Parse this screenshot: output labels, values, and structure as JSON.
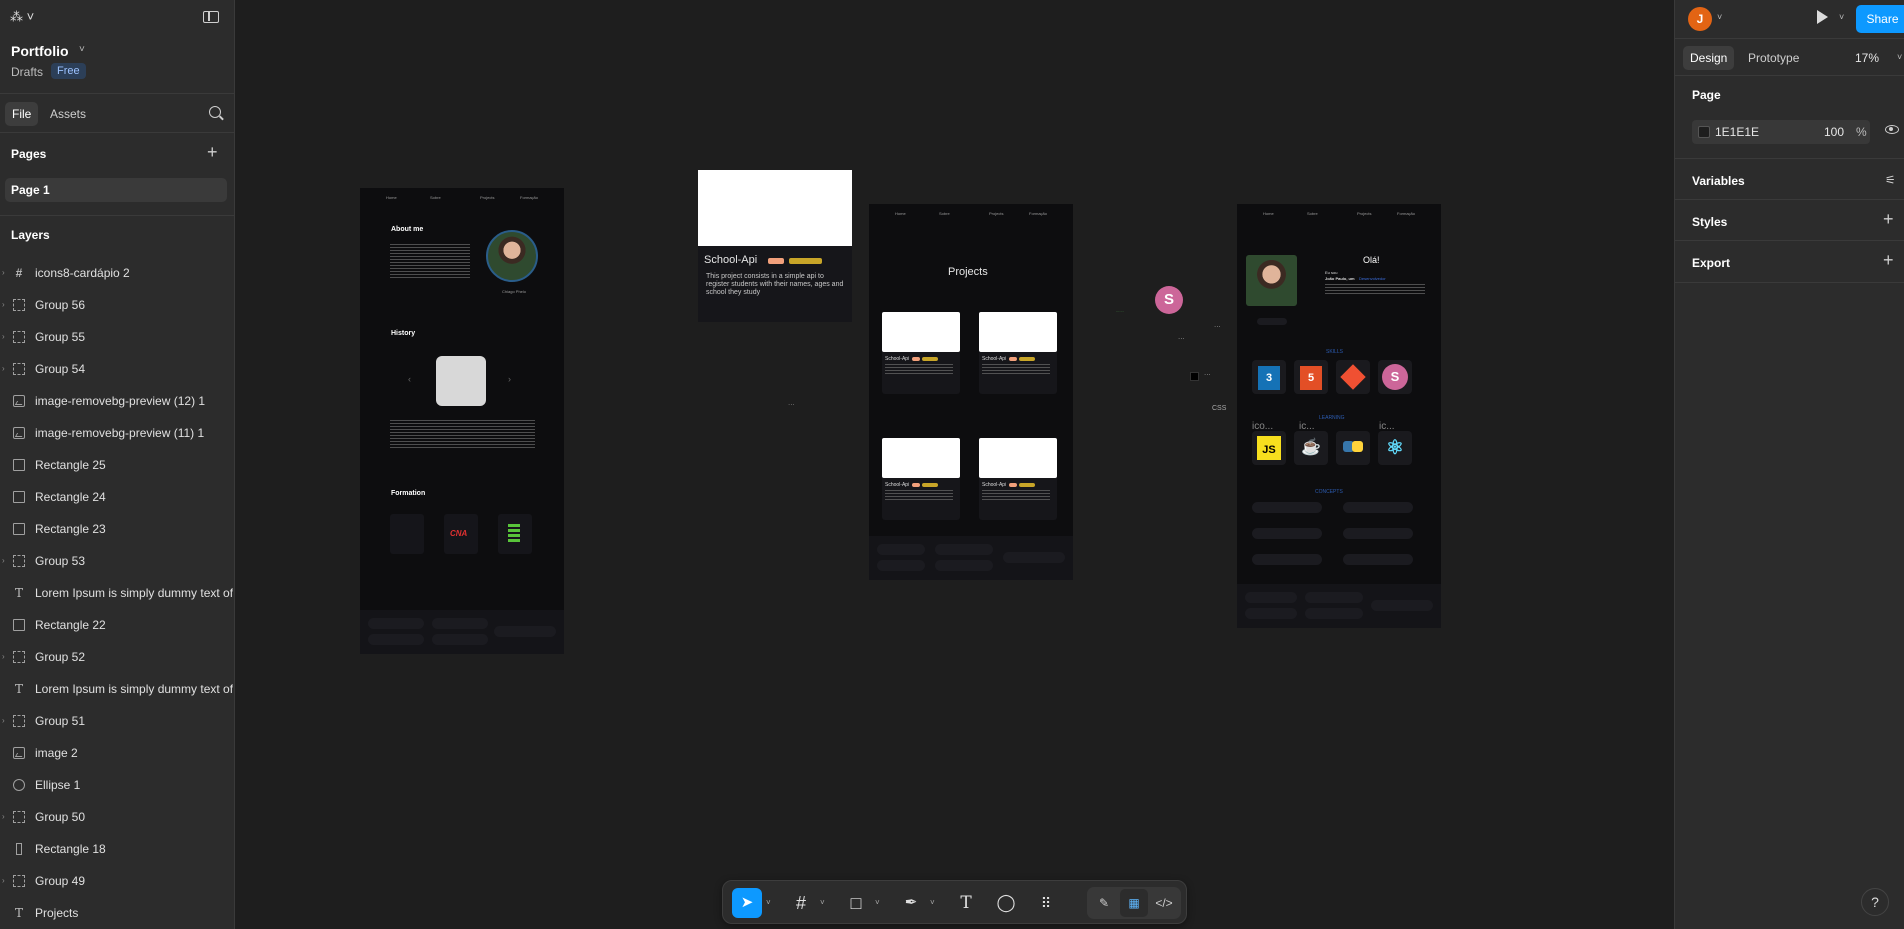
{
  "app": {
    "file_name": "Portfolio",
    "location": "Drafts",
    "plan_badge": "Free"
  },
  "left_panel": {
    "tabs": [
      "File",
      "Assets"
    ],
    "pages_title": "Pages",
    "pages": [
      "Page 1"
    ],
    "layers_title": "Layers",
    "layers": [
      {
        "type": "frame",
        "name": "icons8-cardápio 2"
      },
      {
        "type": "group",
        "name": "Group 56"
      },
      {
        "type": "group",
        "name": "Group 55"
      },
      {
        "type": "group",
        "name": "Group 54"
      },
      {
        "type": "image",
        "name": "image-removebg-preview (12) 1"
      },
      {
        "type": "image",
        "name": "image-removebg-preview (11) 1"
      },
      {
        "type": "rect",
        "name": "Rectangle 25"
      },
      {
        "type": "rect",
        "name": "Rectangle 24"
      },
      {
        "type": "rect",
        "name": "Rectangle 23"
      },
      {
        "type": "group",
        "name": "Group 53"
      },
      {
        "type": "text",
        "name": "Lorem Ipsum is simply dummy text of"
      },
      {
        "type": "rect",
        "name": "Rectangle 22"
      },
      {
        "type": "group",
        "name": "Group 52"
      },
      {
        "type": "text",
        "name": "Lorem Ipsum is simply dummy text of"
      },
      {
        "type": "group",
        "name": "Group 51"
      },
      {
        "type": "image",
        "name": "image 2"
      },
      {
        "type": "ellipse",
        "name": "Ellipse 1"
      },
      {
        "type": "group",
        "name": "Group 50"
      },
      {
        "type": "tall",
        "name": "Rectangle 18"
      },
      {
        "type": "group",
        "name": "Group 49"
      },
      {
        "type": "text",
        "name": "Projects"
      }
    ]
  },
  "right_panel": {
    "avatar_initial": "J",
    "share_label": "Share",
    "tabs": [
      "Design",
      "Prototype"
    ],
    "zoom": "17%",
    "page_section": "Page",
    "page_color_hex": "1E1E1E",
    "page_opacity": "100",
    "page_opacity_unit": "%",
    "variables": "Variables",
    "styles": "Styles",
    "export": "Export",
    "accent": "#0d99ff"
  },
  "canvas": {
    "frame1": {
      "about_title": "About me",
      "history_title": "History",
      "formation_title": "Formation",
      "photo_caption": "Chiago Phelo",
      "logo_text": "CNA"
    },
    "card": {
      "title": "School-Api",
      "description": "This project consists in a simple api to register students with their names, ages and school they study"
    },
    "frame2": {
      "title": "Projects",
      "card_title": "School-Api"
    },
    "frame3": {
      "greeting": "Olá!",
      "intro_line1": "Eu sou",
      "intro_line2": "João Paulo, um",
      "intro_highlight": "Desenvolvedor",
      "skills_label": "SKILLS",
      "learning_label": "LEARNING",
      "concepts_label": "CONCEPTS",
      "skill_icons": [
        "css3-icon",
        "html5-icon",
        "git-icon",
        "sass-icon"
      ],
      "learning_icons": [
        "javascript-icon",
        "java-icon",
        "python-icon",
        "react-icon"
      ],
      "icon_placeholders": [
        "ico...",
        "ic...",
        "ic..."
      ]
    },
    "floating": {
      "css_label": "CSS",
      "dots": "..."
    }
  },
  "toolbar": {
    "tools": [
      "move-tool",
      "frame-tool",
      "shape-tool",
      "pen-tool",
      "text-tool",
      "comment-tool",
      "actions-tool"
    ],
    "modes": [
      "draw-mode",
      "design-mode",
      "dev-mode"
    ]
  },
  "help": "?"
}
